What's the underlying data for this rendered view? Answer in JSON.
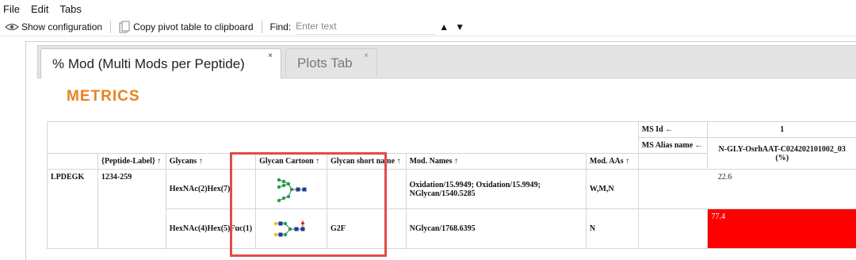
{
  "menu": [
    "File",
    "Edit",
    "Tabs"
  ],
  "toolbar": {
    "show_config": "Show configuration",
    "copy_pivot": "Copy pivot table to clipboard",
    "find_label": "Find:",
    "find_placeholder": "Enter text",
    "up_arrow": "▲",
    "down_arrow": "▼"
  },
  "tabs": [
    {
      "label": "% Mod (Multi Mods per Peptide)",
      "close": "×",
      "active": true
    },
    {
      "label": "Plots Tab",
      "close": "×",
      "active": false
    }
  ],
  "metrics_title": "METRICS",
  "table": {
    "ms_id_label": "MS Id ←",
    "ms_id_value": "1",
    "ms_alias_label": "MS Alias name ←",
    "ms_alias_value": "N-GLY-OsrhAAT-C024202101002_03 (%)",
    "headers": {
      "peptide_label": "{Peptide-Label} ↑",
      "glycans": "Glycans ↑",
      "glycan_cartoon": "Glycan Cartoon ↑",
      "glycan_short": "Glycan short name ↑",
      "mod_names": "Mod. Names ↑",
      "mod_aas": "Mod. AAs ↑"
    },
    "row_label": "LPDEGK",
    "peptide": "1234-259",
    "rows": [
      {
        "glycan": "HexNAc(2)Hex(7)",
        "short": "",
        "mod_names": "Oxidation/15.9949; Oxidation/15.9949; NGlycan/1540.5285",
        "mod_aas": "W,M,N",
        "value": "22.6"
      },
      {
        "glycan": "HexNAc(4)Hex(5)Fuc(1)",
        "short": "G2F",
        "mod_names": "NGlycan/1768.6395",
        "mod_aas": "N",
        "value": "77.4"
      }
    ]
  },
  "colors": {
    "accent_orange": "#e8821e",
    "highlight_red": "#ff0000",
    "annotation_box": "#e34b4b"
  }
}
